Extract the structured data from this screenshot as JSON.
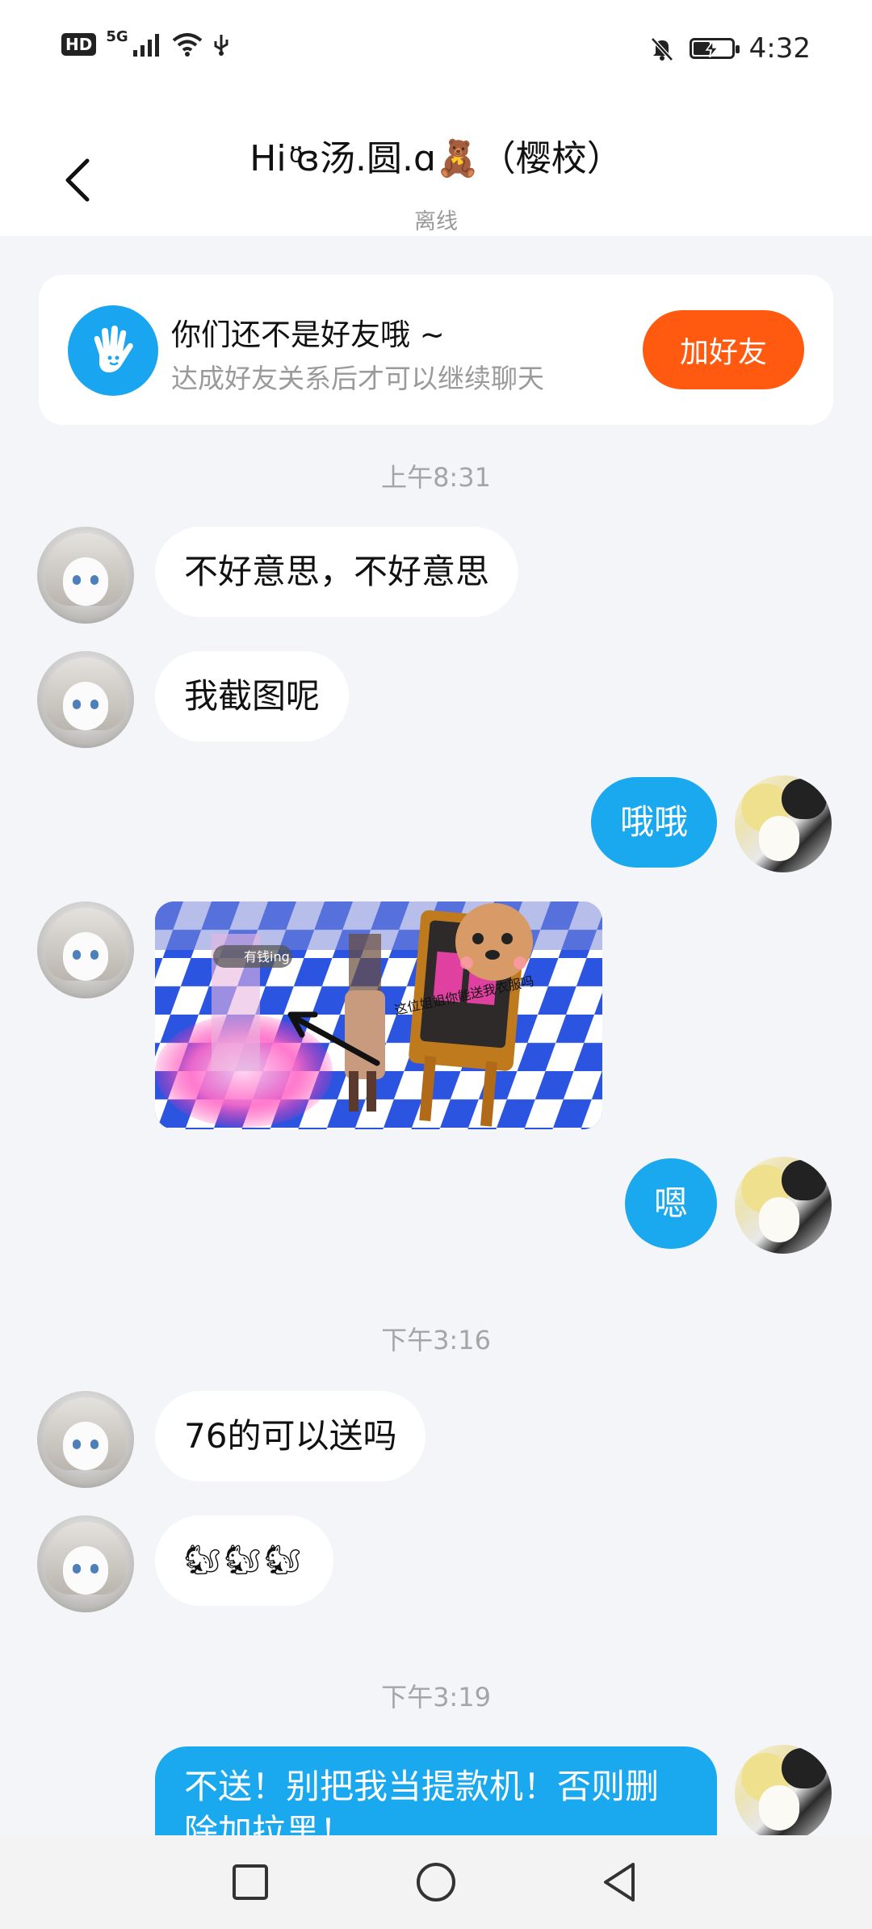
{
  "status_bar": {
    "left_icons": [
      "hd-icon",
      "signal-5g-icon",
      "wifi-icon",
      "usb-icon"
    ],
    "hd_label": "HD",
    "network_label": "5G",
    "right_icons": [
      "mute-bell-icon",
      "battery-charging-icon"
    ],
    "time": "4:32"
  },
  "header": {
    "title": "Hi ͦ̈ɞ汤.圆.ɑ🧸（樱校）",
    "status": "离线"
  },
  "friend_card": {
    "title": "你们还不是好友哦 ~",
    "subtitle": "达成好友关系后才可以继续聊天",
    "button": "加好友"
  },
  "messages": {
    "time1": "上午8:31",
    "m1": "不好意思，不好意思",
    "m2": "我截图呢",
    "m3": "哦哦",
    "m4_image_texts": {
      "tag": "有钱ing",
      "caption": "这位姐姐你能送我衣服吗"
    },
    "m5": "嗯",
    "time2": "下午3:16",
    "m6": "76的可以送吗",
    "m7": "🐿🐿🐿",
    "time3": "下午3:19",
    "m8": "不送！别把我当提款机！否则删除加拉黑！"
  },
  "colors": {
    "background": "#f3f5f8",
    "accent_blue": "#1aa8ef",
    "add_button": "#ff5a10",
    "muted_text": "#9a9a9a"
  },
  "nav_bar": {
    "icons": [
      "recents-square-icon",
      "home-circle-icon",
      "back-triangle-icon"
    ]
  }
}
